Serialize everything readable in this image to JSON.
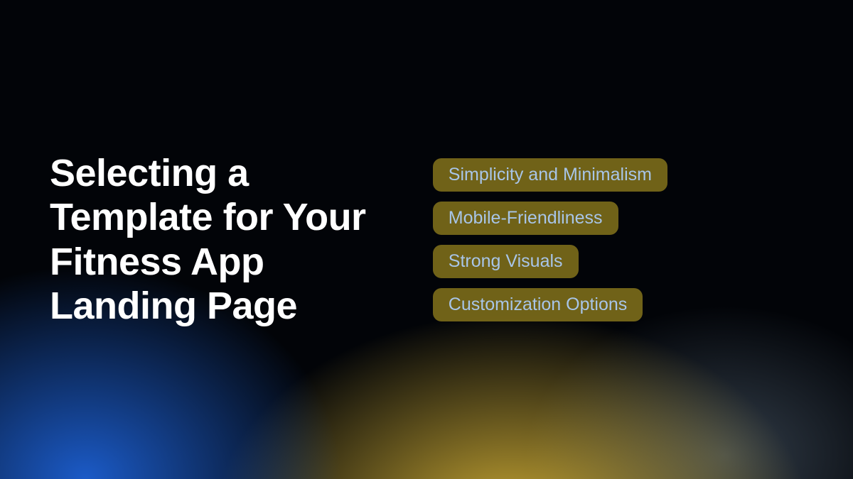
{
  "headline": "Selecting a Template for Your Fitness App Landing Page",
  "pills": [
    "Simplicity and Minimalism",
    "Mobile-Friendliness",
    "Strong Visuals",
    "Customization Options"
  ]
}
